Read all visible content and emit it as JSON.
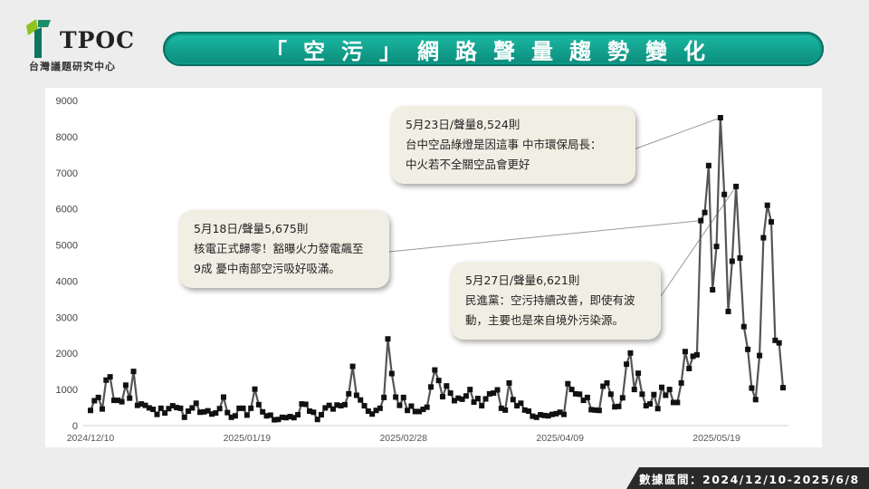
{
  "logo": {
    "text": "TPOC",
    "sub": "台灣議題研究中心"
  },
  "title": "「空污」網路聲量趨勢變化",
  "footer": "數據區間：2024/12/10-2025/6/8",
  "colors": {
    "accent": "#0f9a88",
    "line": "#555555",
    "marker": "#111111"
  },
  "callouts": [
    {
      "lines": [
        "5月23日/聲量8,524則",
        "台中空品綠燈是因這事 中市環保局長：",
        "中火若不全關空品會更好"
      ]
    },
    {
      "lines": [
        "5月18日/聲量5,675則",
        "核電正式歸零！豁曝火力發電飆至",
        "9成 憂中南部空污吸好吸滿。"
      ]
    },
    {
      "lines": [
        "5月27日/聲量6,621則",
        "民進黨：空污持續改善，即使有波",
        "動，主要也是來自境外污染源。"
      ]
    }
  ],
  "chart_data": {
    "type": "line",
    "x_start": "2024-12-10",
    "xtick_labels": [
      "2024/12/10",
      "2025/01/19",
      "2025/02/28",
      "2025/04/09",
      "2025/05/19"
    ],
    "ylim": [
      0,
      9000
    ],
    "ytick_labels": [
      "0",
      "1000",
      "2000",
      "3000",
      "4000",
      "5000",
      "6000",
      "7000",
      "8000",
      "9000"
    ],
    "grid": false,
    "legend": "none",
    "values": [
      420,
      690,
      780,
      460,
      1260,
      1350,
      700,
      700,
      660,
      1120,
      760,
      1500,
      560,
      600,
      560,
      490,
      450,
      310,
      480,
      350,
      470,
      550,
      500,
      480,
      230,
      400,
      490,
      620,
      370,
      380,
      410,
      320,
      350,
      470,
      790,
      360,
      230,
      270,
      480,
      480,
      290,
      480,
      1010,
      580,
      380,
      270,
      290,
      160,
      170,
      230,
      220,
      250,
      220,
      300,
      600,
      590,
      400,
      370,
      170,
      300,
      490,
      560,
      460,
      570,
      550,
      580,
      880,
      1640,
      840,
      710,
      550,
      400,
      320,
      420,
      480,
      780,
      2400,
      1440,
      790,
      560,
      780,
      420,
      540,
      390,
      390,
      450,
      510,
      1070,
      1540,
      1250,
      800,
      1100,
      900,
      690,
      760,
      730,
      820,
      1000,
      650,
      750,
      550,
      740,
      880,
      900,
      990,
      480,
      430,
      1180,
      720,
      550,
      620,
      430,
      400,
      260,
      230,
      300,
      280,
      270,
      310,
      330,
      370,
      310,
      1160,
      1000,
      880,
      870,
      700,
      780,
      440,
      430,
      420,
      1090,
      1180,
      870,
      520,
      530,
      770,
      1700,
      2010,
      1000,
      1450,
      870,
      550,
      600,
      860,
      470,
      1060,
      840,
      1000,
      640,
      640,
      1180,
      2050,
      1580,
      1920,
      1960,
      5675,
      5900,
      7200,
      3760,
      4960,
      8524,
      6400,
      3160,
      4550,
      6621,
      4640,
      2740,
      2110,
      1040,
      720,
      1940,
      5200,
      6100,
      5640,
      2360,
      2290,
      1050
    ]
  }
}
